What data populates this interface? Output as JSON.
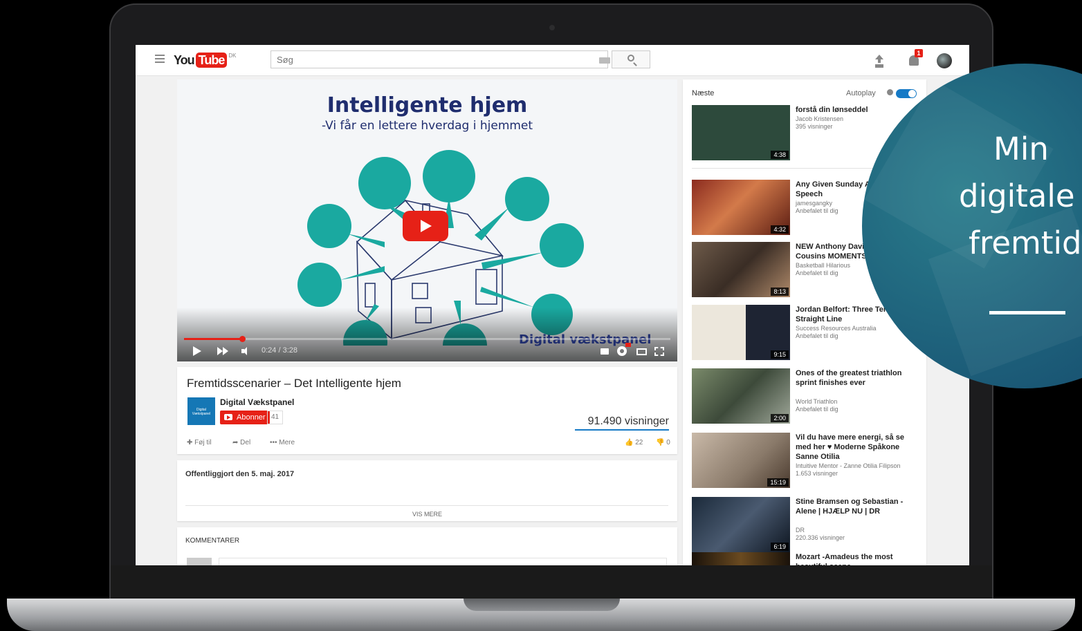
{
  "header": {
    "logo_you": "You",
    "logo_tube": "Tube",
    "logo_country": "DK",
    "search_placeholder": "Søg",
    "notification_count": "1"
  },
  "player": {
    "promo_title": "Intelligente hjem",
    "promo_subtitle": "-Vi får en lettere hverdag i hjemmet",
    "watermark": "Digital vækstpanel",
    "time": "0:24 / 3:28",
    "progress": 0.12,
    "accent": "#e62117",
    "diagram_color": "#1aa9a0"
  },
  "video": {
    "title": "Fremtidsscenarier – Det Intelligente hjem",
    "channel_name": "Digital Vækstpanel",
    "channel_thumb_text": "Digital Vækstpanel",
    "subscribe_label": "Abonner",
    "subscriber_count": "41",
    "views": "91.490 visninger",
    "add_to_label": "Føj til",
    "share_label": "Del",
    "more_label": "Mere",
    "likes": "22",
    "dislikes": "0",
    "published": "Offentliggjort den 5. maj. 2017",
    "show_more_label": "VIS MERE",
    "comments_heading": "KOMMENTARER"
  },
  "sidebar": {
    "next_label": "Næste",
    "autoplay_label": "Autoplay",
    "autoplay_on": true,
    "items": [
      {
        "title": "forstå din lønseddel",
        "channel": "Jacob Kristensen",
        "meta": "395 visninger",
        "duration": "4:38"
      },
      {
        "title": "Any Given Sunday A Pre-Game Speech",
        "channel": "jamesgangky",
        "meta": "Anbefalet til dig",
        "duration": "4:32"
      },
      {
        "title": "NEW Anthony Davi DeMarcus Cousins MOMENTS!",
        "channel": "Basketball Hilarious",
        "meta": "Anbefalet til dig",
        "duration": "8:13"
      },
      {
        "title": "Jordan Belfort: Three Ter of the Straight Line",
        "channel": "Success Resources Australia",
        "meta": "Anbefalet til dig",
        "duration": "9:15"
      },
      {
        "title": "Ones of the greatest triathlon sprint finishes ever",
        "channel": "World Triathlon",
        "meta": "Anbefalet til dig",
        "duration": "2:00"
      },
      {
        "title": "Vil du have mere energi, så se med her ♥ Moderne Spåkone Sanne Otilia",
        "channel": "Intuitive Mentor - Zanne Otilia Filipson",
        "meta": "1.653 visninger",
        "duration": "15:19"
      },
      {
        "title": "Stine Bramsen og Sebastian - Alene | HJÆLP NU | DR",
        "channel": "DR",
        "meta": "220.336 visninger",
        "duration": "6:19"
      },
      {
        "title": "Mozart -Amadeus the most beautiful scene",
        "channel": "",
        "meta": "",
        "duration": ""
      }
    ]
  },
  "overlay": {
    "line1": "Min",
    "line2": "digitale",
    "line3": "fremtid"
  }
}
